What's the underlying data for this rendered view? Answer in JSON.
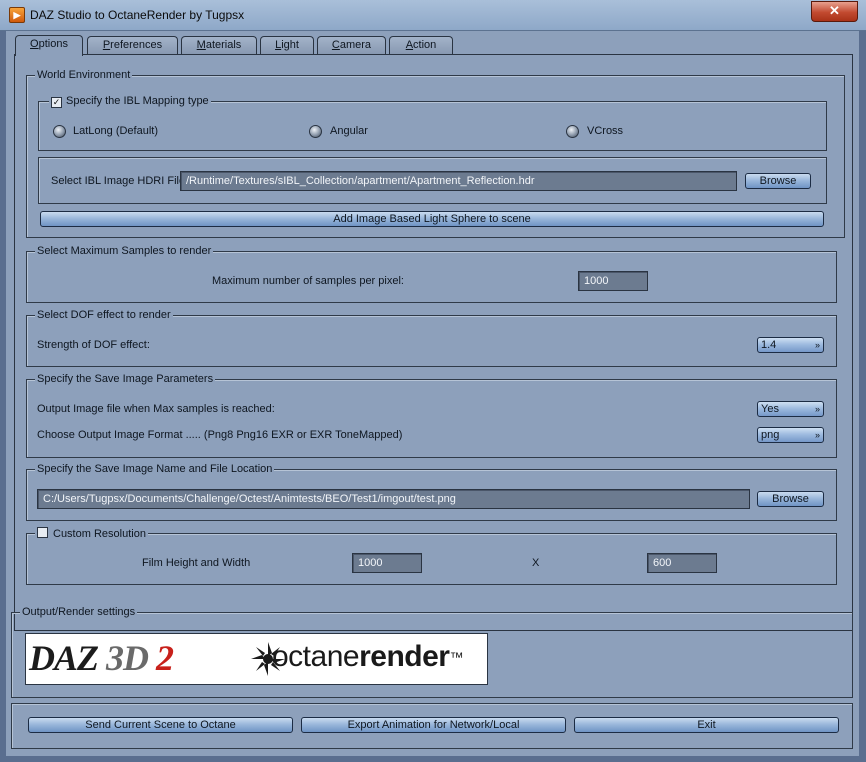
{
  "window": {
    "title": "DAZ Studio to OctaneRender by Tugpsx",
    "close_label": "✕"
  },
  "tabs": [
    {
      "label": "Options",
      "underline": "O",
      "rest": "ptions"
    },
    {
      "label": "Preferences",
      "underline": "P",
      "rest": "references"
    },
    {
      "label": "Materials",
      "underline": "M",
      "rest": "aterials"
    },
    {
      "label": "Light",
      "underline": "L",
      "rest": "ight"
    },
    {
      "label": "Camera",
      "underline": "C",
      "rest": "amera"
    },
    {
      "label": "Action",
      "underline": "A",
      "rest": "ction"
    }
  ],
  "world_env": {
    "title": "World Environment",
    "ibl_mapping": {
      "checkbox_label": "Specify the IBL Mapping type",
      "checked": true,
      "options": [
        "LatLong  (Default)",
        "Angular",
        "VCross"
      ]
    },
    "hdri_label": "Select IBL Image HDRI File",
    "hdri_path": "/Runtime/Textures/sIBL_Collection/apartment/Apartment_Reflection.hdr",
    "browse_label": "Browse",
    "add_sphere_label": "Add Image Based Light Sphere to scene"
  },
  "samples": {
    "title": "Select Maximum Samples to render",
    "label": "Maximum number of samples per pixel:",
    "value": "1000"
  },
  "dof": {
    "title": "Select DOF effect to render",
    "label": "Strength of DOF effect:",
    "value": "1.4"
  },
  "save_params": {
    "title": "Specify the Save Image Parameters",
    "output_label": "Output Image file when Max samples is reached:",
    "output_value": "Yes",
    "format_label": "Choose Output Image Format ..... (Png8 Png16 EXR or EXR ToneMapped)",
    "format_value": "png"
  },
  "save_location": {
    "title": "Specify the Save Image Name and File Location",
    "path": "C:/Users/Tugpsx/Documents/Challenge/Octest/Animtests/BEO/Test1/imgout/test.png",
    "browse_label": "Browse"
  },
  "resolution": {
    "checkbox_label": "Custom Resolution",
    "checked": false,
    "label": "Film Height and Width",
    "height": "1000",
    "separator": "X",
    "width": "600"
  },
  "output_render": {
    "title": "Output/Render settings",
    "logo_daz": "DAZ",
    "logo_3d": "3D",
    "logo_2": "2",
    "logo_octane": "octane",
    "logo_render": "render",
    "logo_tm": "™"
  },
  "footer": {
    "send_label": "Send Current Scene to Octane",
    "export_label": "Export Animation for Network/Local",
    "exit_label": "Exit"
  }
}
